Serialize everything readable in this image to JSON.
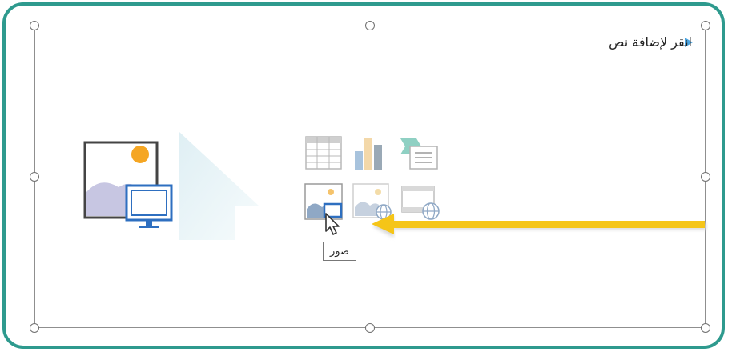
{
  "placeholder": {
    "text": "انقر لإضافة نص"
  },
  "tooltip": {
    "text": "صور"
  },
  "content_icons": [
    {
      "name": "table-icon"
    },
    {
      "name": "chart-icon"
    },
    {
      "name": "smartart-icon"
    },
    {
      "name": "pictures-icon"
    },
    {
      "name": "online-pictures-icon"
    },
    {
      "name": "video-icon"
    }
  ],
  "colors": {
    "frame": "#2e9a8e",
    "arrow": "#f5c518",
    "accent_blue": "#2e6fc0",
    "bullet": "#4aa3df"
  }
}
